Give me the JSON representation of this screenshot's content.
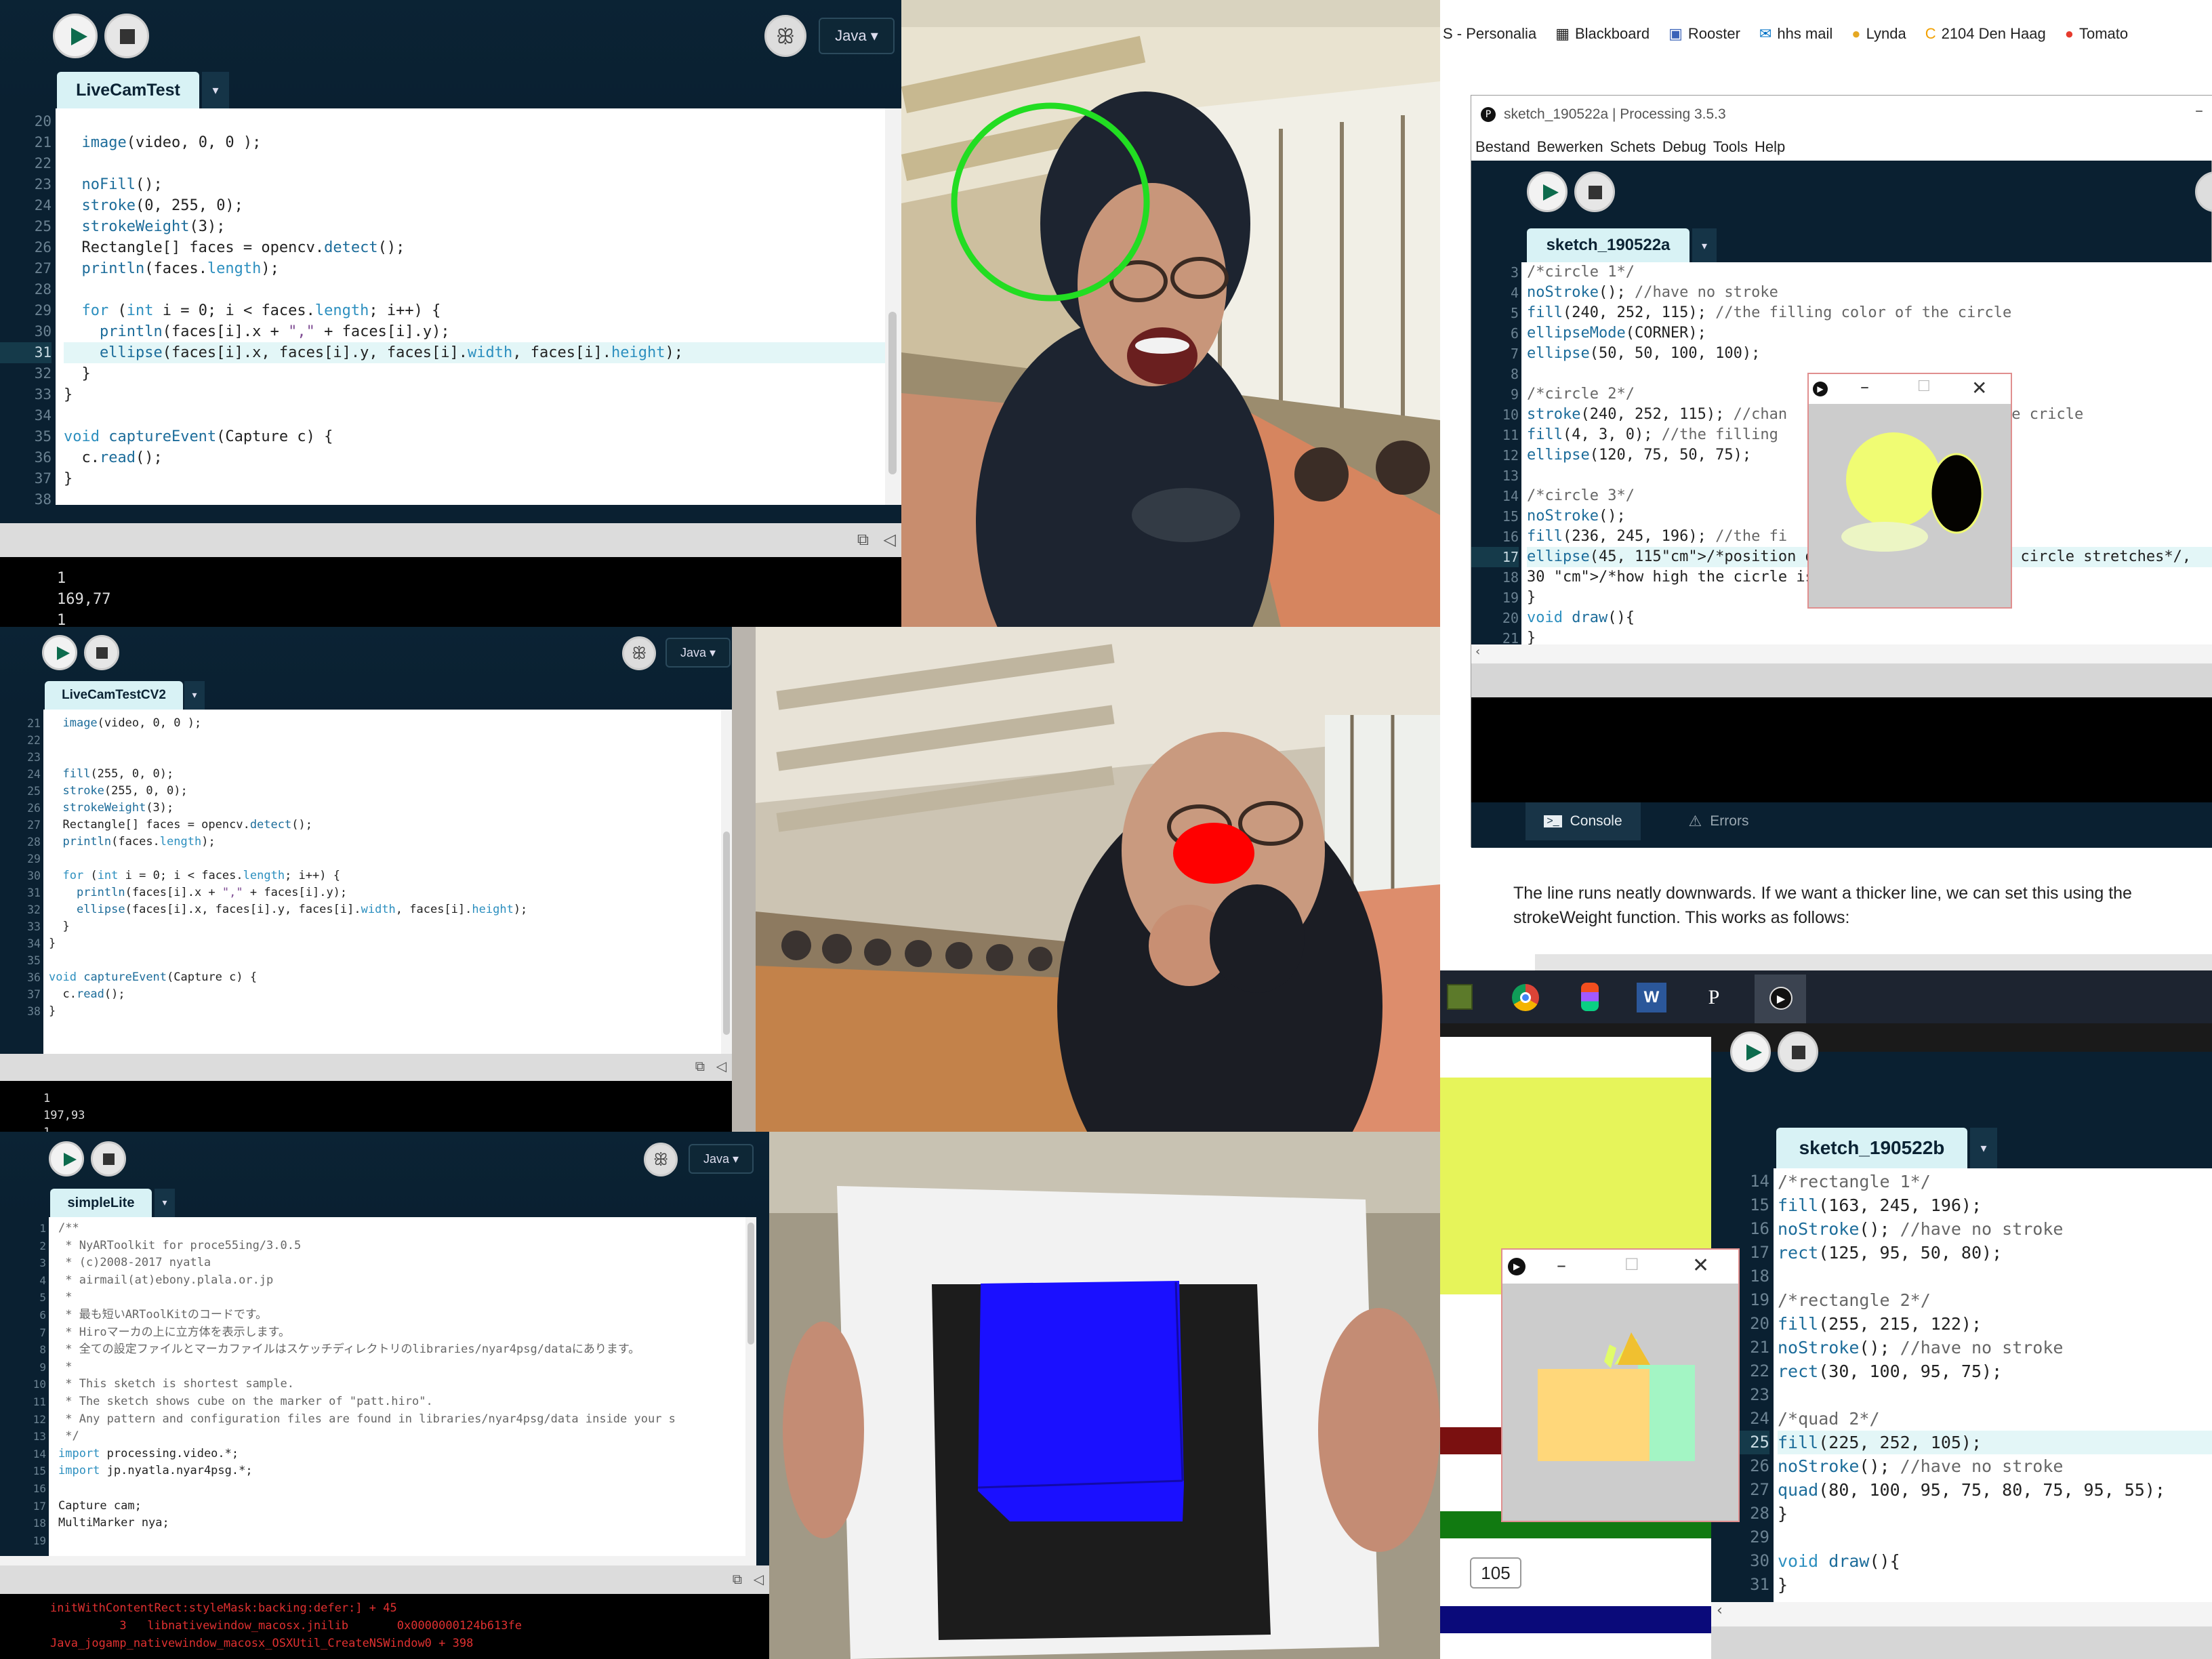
{
  "panel1": {
    "tab": "LiveCamTest",
    "mode": "Java",
    "lines": [
      {
        "n": "20",
        "t": ""
      },
      {
        "n": "21",
        "t": "  image(video, 0, 0 );"
      },
      {
        "n": "22",
        "t": ""
      },
      {
        "n": "23",
        "t": "  noFill();"
      },
      {
        "n": "24",
        "t": "  stroke(0, 255, 0);"
      },
      {
        "n": "25",
        "t": "  strokeWeight(3);"
      },
      {
        "n": "26",
        "t": "  Rectangle[] faces = opencv.detect();"
      },
      {
        "n": "27",
        "t": "  println(faces.length);"
      },
      {
        "n": "28",
        "t": ""
      },
      {
        "n": "29",
        "t": "  for (int i = 0; i < faces.length; i++) {"
      },
      {
        "n": "30",
        "t": "    println(faces[i].x + \",\" + faces[i].y);"
      },
      {
        "n": "31",
        "t": "    ellipse(faces[i].x, faces[i].y, faces[i].width, faces[i].height);"
      },
      {
        "n": "32",
        "t": "  }"
      },
      {
        "n": "33",
        "t": "}"
      },
      {
        "n": "34",
        "t": ""
      },
      {
        "n": "35",
        "t": "void captureEvent(Capture c) {"
      },
      {
        "n": "36",
        "t": "  c.read();"
      },
      {
        "n": "37",
        "t": "}"
      },
      {
        "n": "38",
        "t": ""
      }
    ],
    "highlight_line": "31",
    "console": [
      "1",
      "169,77",
      "1"
    ]
  },
  "panel2": {
    "tab": "LiveCamTestCV2",
    "mode": "Java",
    "lines": [
      {
        "n": "21",
        "t": "  image(video, 0, 0 );"
      },
      {
        "n": "22",
        "t": ""
      },
      {
        "n": "23",
        "t": ""
      },
      {
        "n": "24",
        "t": "  fill(255, 0, 0);"
      },
      {
        "n": "25",
        "t": "  stroke(255, 0, 0);"
      },
      {
        "n": "26",
        "t": "  strokeWeight(3);"
      },
      {
        "n": "27",
        "t": "  Rectangle[] faces = opencv.detect();"
      },
      {
        "n": "28",
        "t": "  println(faces.length);"
      },
      {
        "n": "29",
        "t": ""
      },
      {
        "n": "30",
        "t": "  for (int i = 0; i < faces.length; i++) {"
      },
      {
        "n": "31",
        "t": "    println(faces[i].x + \",\" + faces[i].y);"
      },
      {
        "n": "32",
        "t": "    ellipse(faces[i].x, faces[i].y, faces[i].width, faces[i].height);"
      },
      {
        "n": "33",
        "t": "  }"
      },
      {
        "n": "34",
        "t": "}"
      },
      {
        "n": "35",
        "t": ""
      },
      {
        "n": "36",
        "t": "void captureEvent(Capture c) {"
      },
      {
        "n": "37",
        "t": "  c.read();"
      },
      {
        "n": "38",
        "t": "}"
      }
    ],
    "console": [
      "1",
      "197,93",
      "1"
    ]
  },
  "panel3": {
    "tab": "simpleLite",
    "mode": "Java",
    "lines": [
      {
        "n": "1",
        "t": "/**"
      },
      {
        "n": "2",
        "t": " * NyARToolkit for proce55ing/3.0.5"
      },
      {
        "n": "3",
        "t": " * (c)2008-2017 nyatla"
      },
      {
        "n": "4",
        "t": " * airmail(at)ebony.plala.or.jp"
      },
      {
        "n": "5",
        "t": " *"
      },
      {
        "n": "6",
        "t": " * 最も短いARToolKitのコードです。"
      },
      {
        "n": "7",
        "t": " * Hiroマーカの上に立方体を表示します。"
      },
      {
        "n": "8",
        "t": " * 全ての設定ファイルとマーカファイルはスケッチディレクトリのlibraries/nyar4psg/dataにあります。"
      },
      {
        "n": "9",
        "t": " *"
      },
      {
        "n": "10",
        "t": " * This sketch is shortest sample."
      },
      {
        "n": "11",
        "t": " * The sketch shows cube on the marker of \"patt.hiro\"."
      },
      {
        "n": "12",
        "t": " * Any pattern and configuration files are found in libraries/nyar4psg/data inside your s"
      },
      {
        "n": "13",
        "t": " */"
      },
      {
        "n": "14",
        "t": "import processing.video.*;"
      },
      {
        "n": "15",
        "t": "import jp.nyatla.nyar4psg.*;"
      },
      {
        "n": "16",
        "t": ""
      },
      {
        "n": "17",
        "t": "Capture cam;"
      },
      {
        "n": "18",
        "t": "MultiMarker nya;"
      },
      {
        "n": "19",
        "t": ""
      }
    ],
    "console": [
      "initWithContentRect:styleMask:backing:defer:] + 45",
      "          3   libnativewindow_macosx.jnilib       0x0000000124b613fe",
      "Java_jogamp_nativewindow_macosx_OSXUtil_CreateNSWindow0 + 398"
    ]
  },
  "browser": {
    "bookmarks": [
      "S - Personalia",
      "Blackboard",
      "Rooster",
      "hhs mail",
      "Lynda",
      "2104 Den Haag",
      "Tomato"
    ]
  },
  "panel4": {
    "window_title": "sketch_190522a | Processing 3.5.3",
    "menu": [
      "Bestand",
      "Bewerken",
      "Schets",
      "Debug",
      "Tools",
      "Help"
    ],
    "tab": "sketch_190522a",
    "lines": [
      {
        "n": "3",
        "t": "/*circle 1*/"
      },
      {
        "n": "4",
        "t": "noStroke(); //have no stroke"
      },
      {
        "n": "5",
        "t": "fill(240, 252, 115); //the filling color of the circle"
      },
      {
        "n": "6",
        "t": "ellipseMode(CORNER);"
      },
      {
        "n": "7",
        "t": "ellipse(50, 50, 100, 100);"
      },
      {
        "n": "8",
        "t": ""
      },
      {
        "n": "9",
        "t": "/*circle 2*/"
      },
      {
        "n": "10",
        "t": "stroke(240, 252, 115); //chan                       the cricle"
      },
      {
        "n": "11",
        "t": "fill(4, 3, 0); //the filling"
      },
      {
        "n": "12",
        "t": "ellipse(120, 75, 50, 75);"
      },
      {
        "n": "13",
        "t": ""
      },
      {
        "n": "14",
        "t": "/*circle 3*/"
      },
      {
        "n": "15",
        "t": "noStroke();"
      },
      {
        "n": "16",
        "t": "fill(236, 245, 196); //the fi                      cle"
      },
      {
        "n": "17",
        "t": "ellipse(45, 115/*position dow                     circle stretches*/,"
      },
      {
        "n": "18",
        "t": "30 /*how high the cicrle is*/"
      },
      {
        "n": "19",
        "t": "}"
      },
      {
        "n": "20",
        "t": "void draw(){"
      },
      {
        "n": "21",
        "t": "}"
      }
    ],
    "highlight_line": "17",
    "console_tab": "Console",
    "errors_tab": "Errors"
  },
  "doc": {
    "paragraph": "The line runs neatly downwards. If we want a thicker line, we can set this using the strokeWeight function. This works as follows:"
  },
  "taskbar": {
    "apps": [
      "minecraft-icon",
      "chrome-icon",
      "figma-icon",
      "word-icon",
      "processing-icon",
      "processing-run-icon"
    ]
  },
  "panel5": {
    "tab": "sketch_190522b",
    "lines": [
      {
        "n": "14",
        "t": "/*rectangle 1*/"
      },
      {
        "n": "15",
        "t": "fill(163, 245, 196);"
      },
      {
        "n": "16",
        "t": "noStroke(); //have no stroke"
      },
      {
        "n": "17",
        "t": "rect(125, 95, 50, 80);"
      },
      {
        "n": "18",
        "t": ""
      },
      {
        "n": "19",
        "t": "/*rectangle 2*/"
      },
      {
        "n": "20",
        "t": "fill(255, 215, 122);"
      },
      {
        "n": "21",
        "t": "noStroke(); //have no stroke"
      },
      {
        "n": "22",
        "t": "rect(30, 100, 95, 75);"
      },
      {
        "n": "23",
        "t": ""
      },
      {
        "n": "24",
        "t": "/*quad 2*/"
      },
      {
        "n": "25",
        "t": "fill(225, 252, 105);"
      },
      {
        "n": "26",
        "t": "noStroke(); //have no stroke"
      },
      {
        "n": "27",
        "t": "quad(80, 100, 95, 75, 80, 75, 95, 55);"
      },
      {
        "n": "28",
        "t": "}"
      },
      {
        "n": "29",
        "t": ""
      },
      {
        "n": "30",
        "t": "void draw(){"
      },
      {
        "n": "31",
        "t": "}"
      }
    ],
    "highlight_line": "25",
    "tooltip": "105"
  },
  "colors": {
    "editor_bar": "#0b2334",
    "tab_bg": "#d8f2f5",
    "highlight": "#e3f6f7",
    "keyword": "#2c8fbf",
    "face_circle": "#22dd22",
    "nose": "#ff0000",
    "cube": "#1a10ff"
  }
}
